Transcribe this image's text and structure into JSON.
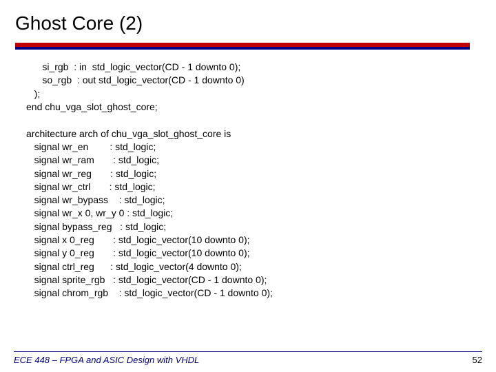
{
  "title": "Ghost Core (2)",
  "code": "      si_rgb  : in  std_logic_vector(CD - 1 downto 0);\n      so_rgb  : out std_logic_vector(CD - 1 downto 0)\n   );\nend chu_vga_slot_ghost_core;\n\narchitecture arch of chu_vga_slot_ghost_core is\n   signal wr_en        : std_logic;\n   signal wr_ram       : std_logic;\n   signal wr_reg       : std_logic;\n   signal wr_ctrl       : std_logic;\n   signal wr_bypass    : std_logic;\n   signal wr_x 0, wr_y 0 : std_logic;\n   signal bypass_reg   : std_logic;\n   signal x 0_reg       : std_logic_vector(10 downto 0);\n   signal y 0_reg       : std_logic_vector(10 downto 0);\n   signal ctrl_reg      : std_logic_vector(4 downto 0);\n   signal sprite_rgb   : std_logic_vector(CD - 1 downto 0);\n   signal chrom_rgb    : std_logic_vector(CD - 1 downto 0);",
  "footer": {
    "course": "ECE 448 – FPGA and ASIC Design with VHDL",
    "page": "52"
  }
}
